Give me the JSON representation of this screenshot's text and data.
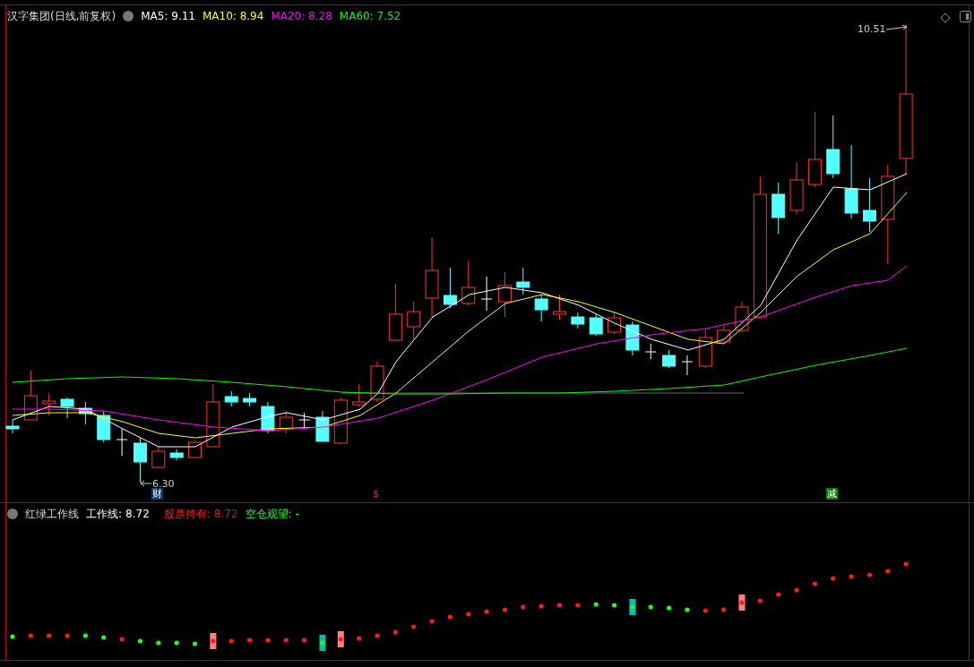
{
  "price_panel": {
    "title": "汉字集团(日线,前复权)",
    "moving_averages": [
      {
        "label": "MA5: 9.11",
        "color": "#ffffff"
      },
      {
        "label": "MA10: 8.94",
        "color": "#ffff00"
      },
      {
        "label": "MA20: 8.28",
        "color": "#ff00ff"
      },
      {
        "label": "MA60: 7.52",
        "color": "#00ff00"
      }
    ],
    "high_label": "10.51",
    "low_label": "6.30",
    "event_markers": [
      {
        "kind": "finance",
        "text": "财"
      },
      {
        "kind": "dividend",
        "text": "$"
      },
      {
        "kind": "reduce",
        "text": "减"
      }
    ]
  },
  "indicator_panel": {
    "title": "红绿工作线",
    "values": [
      {
        "kind": "work",
        "label": "工作线:",
        "value": "8.72"
      },
      {
        "kind": "hold",
        "label": "股票持有:",
        "value": "8.72"
      },
      {
        "kind": "empty",
        "label": "空仓观望:",
        "value": "-"
      }
    ]
  }
}
